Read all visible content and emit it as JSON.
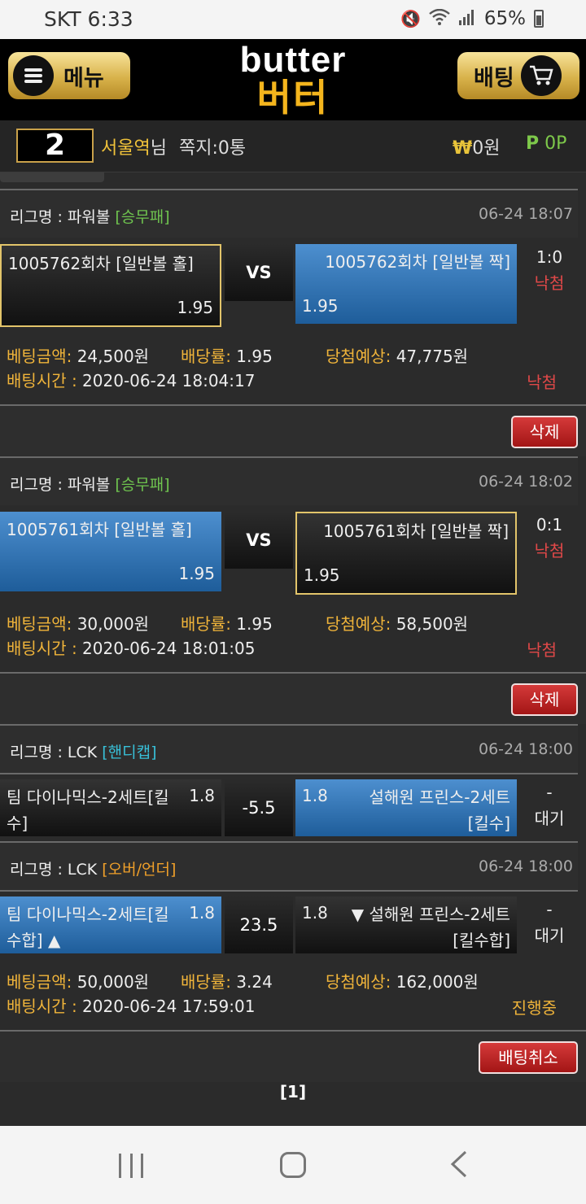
{
  "status": {
    "carrier_time": "SKT 6:33",
    "icons": [
      "mute-icon",
      "wifi-icon",
      "signal-icon"
    ],
    "battery": "65%"
  },
  "header": {
    "menu_label": "메뉴",
    "logo_en": "butter",
    "logo_ko": "버터",
    "bet_label": "배팅"
  },
  "user": {
    "level": "2",
    "name": "서울역",
    "name_suffix": "님",
    "note": "쪽지:0통",
    "money_symbol": "₩",
    "money": "0원",
    "points_symbol": "P",
    "points": "0P"
  },
  "bets": [
    {
      "league_label": "리그명 : 파워볼",
      "league_type": "[승무패]",
      "time": "06-24 18:07",
      "home_name": "1005762회차 [일반볼 홀]",
      "home_odds": "1.95",
      "mid": "VS",
      "away_name": "1005762회차 [일반볼 짝]",
      "away_odds": "1.95",
      "score": "1:0",
      "result": "낙첨",
      "amount_label": "베팅금액:",
      "amount": " 24,500원",
      "rate_label": "배당률:",
      "rate": " 1.95",
      "expect_label": "당첨예상:",
      "expect": " 47,775원",
      "time_label": "배팅시간 :",
      "bet_time": " 2020-06-24 18:04:17",
      "status": "낙첨",
      "action": "삭제"
    },
    {
      "league_label": "리그명 : 파워볼",
      "league_type": "[승무패]",
      "time": "06-24 18:02",
      "home_name": "1005761회차 [일반볼 홀]",
      "home_odds": "1.95",
      "mid": "VS",
      "away_name": "1005761회차 [일반볼 짝]",
      "away_odds": "1.95",
      "score": "0:1",
      "result": "낙첨",
      "amount_label": "베팅금액:",
      "amount": " 30,000원",
      "rate_label": "배당률:",
      "rate": " 1.95",
      "expect_label": "당첨예상:",
      "expect": " 58,500원",
      "time_label": "배팅시간 :",
      "bet_time": " 2020-06-24 18:01:05",
      "status": "낙첨",
      "action": "삭제"
    },
    {
      "league1_label": "리그명 : LCK",
      "league1_type": "[핸디캡]",
      "league1_time": "06-24 18:00",
      "l1_home_name": "팀 다이나믹스-2세트[킬수]",
      "l1_home_odds": "1.8",
      "l1_mid": "-5.5",
      "l1_away_name": "설해원 프린스-2세트 [킬수]",
      "l1_away_odds": "1.8",
      "l1_score": "-",
      "l1_result": "대기",
      "league2_label": "리그명 : LCK",
      "league2_type": "[오버/언더]",
      "league2_time": "06-24 18:00",
      "l2_home_name": "팀 다이나믹스-2세트[킬수합] ▲",
      "l2_home_odds": "1.8",
      "l2_mid": "23.5",
      "l2_away_name": "▼ 설해원 프린스-2세트 [킬수합]",
      "l2_away_odds": "1.8",
      "l2_score": "-",
      "l2_result": "대기",
      "amount_label": "베팅금액:",
      "amount": " 50,000원",
      "rate_label": "배당률:",
      "rate": " 3.24",
      "expect_label": "당첨예상:",
      "expect": " 162,000원",
      "time_label": "배팅시간 :",
      "bet_time": " 2020-06-24 17:59:01",
      "status": "진행중",
      "action": "배팅취소"
    }
  ],
  "pager": "[1]",
  "colors": {
    "accent_gold": "#f0b43a",
    "blue_selected": "#2f6fb3",
    "red_button": "#c02020",
    "league_green": "#6fc44f",
    "league_cyan": "#38c0d8",
    "league_orange": "#f0a02a"
  }
}
